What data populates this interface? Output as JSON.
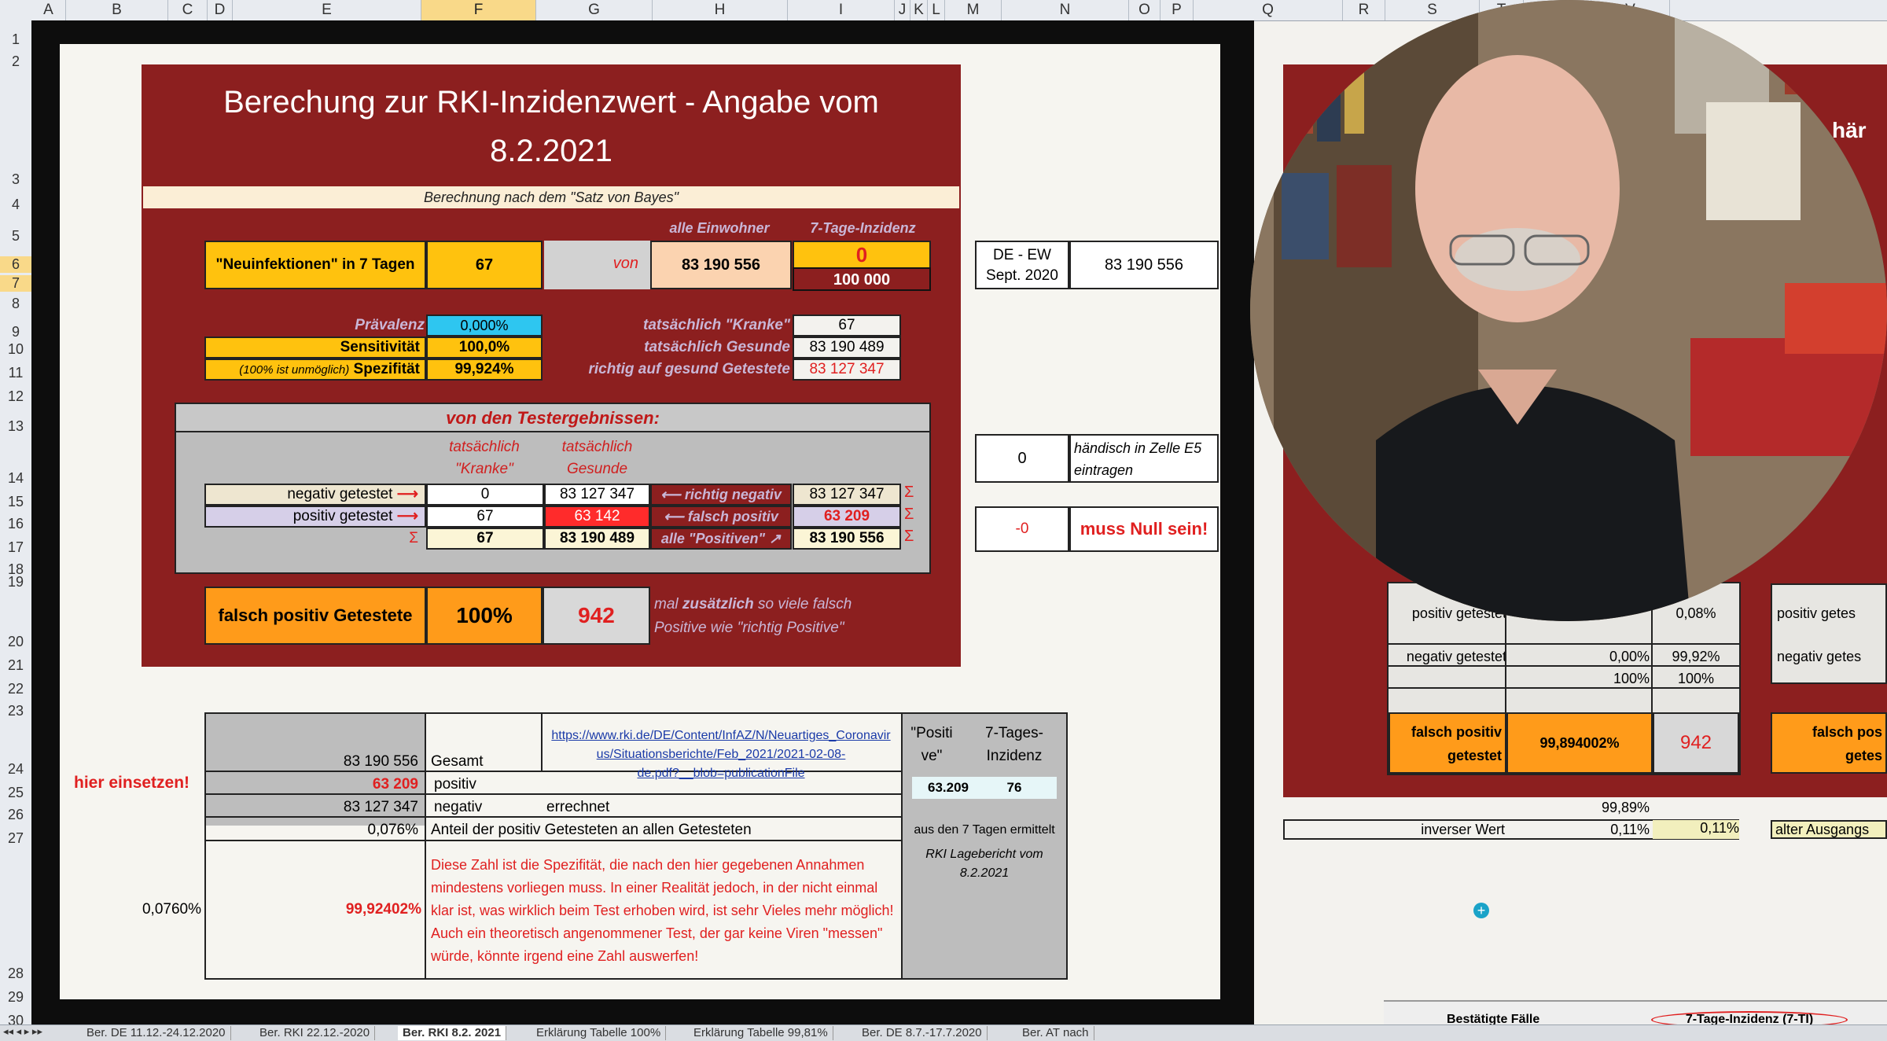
{
  "columns": [
    "A",
    "B",
    "C",
    "D",
    "E",
    "F",
    "G",
    "H",
    "I",
    "J",
    "K",
    "L",
    "M",
    "N",
    "O",
    "P",
    "Q",
    "R",
    "S",
    "T",
    "U",
    "V"
  ],
  "rows": [
    "1",
    "2",
    "3",
    "4",
    "5",
    "6",
    "7",
    "8",
    "9",
    "10",
    "11",
    "12",
    "13",
    "14",
    "15",
    "16",
    "17",
    "18",
    "19",
    "20",
    "21",
    "22",
    "23",
    "24",
    "25",
    "26",
    "27",
    "28",
    "29",
    "30"
  ],
  "selected_column": "F",
  "title_line1": "Berechung zur RKI-Inzidenzwert - Angabe vom",
  "title_line2": "8.2.2021",
  "subtitle": "Berechnung nach dem \"Satz von Bayes\"",
  "hdr_alle_einwohner": "alle Einwohner",
  "hdr_7tage": "7-Tage-Inzidenz",
  "neuinf_label": "\"Neuinfektionen\" in 7 Tagen",
  "neuinf_value": "67",
  "von": "von",
  "einwohner": "83 190 556",
  "inzidenz_top": "0",
  "inzidenz_bottom": "100 000",
  "de_ew_label1": "DE - EW",
  "de_ew_label2": "Sept. 2020",
  "de_ew_value": "83 190 556",
  "praevalenz_label": "Prävalenz",
  "praevalenz_value": "0,000%",
  "sensitivitaet_label": "Sensitivität",
  "sensitivitaet_value": "100,0%",
  "spezifitaet_note": "(100% ist unmöglich)",
  "spezifitaet_label": "Spezifität",
  "spezifitaet_value": "99,924%",
  "kranke_label": "tatsächlich \"Kranke\"",
  "kranke_value": "67",
  "gesunde_label": "tatsächlich Gesunde",
  "gesunde_value": "83 190 489",
  "richtig_gesund_label": "richtig auf gesund Getestete",
  "richtig_gesund_value": "83 127 347",
  "test_header": "von den Testergebnissen:",
  "col_kranke1": "tatsächlich",
  "col_kranke2": "\"Kranke\"",
  "col_gesunde1": "tatsächlich",
  "col_gesunde2": "Gesunde",
  "neg_label": "negativ getestet",
  "neg_kranke": "0",
  "neg_gesunde": "83 127 347",
  "richtig_negativ": "richtig negativ",
  "neg_sum": "83 127 347",
  "pos_label": "positiv getestet",
  "pos_kranke": "67",
  "pos_gesunde": "63 142",
  "falsch_positiv": "falsch positiv",
  "pos_sum": "63 209",
  "sum_symbol": "Σ",
  "sum_kranke": "67",
  "sum_gesunde": "83 190 489",
  "alle_positiven": "alle \"Positiven\"",
  "sum_total": "83 190 556",
  "haendisch_value": "0",
  "haendisch_text1": "händisch in Zelle E5",
  "haendisch_text2": "eintragen",
  "null_value": "-0",
  "null_text": "muss Null sein!",
  "fp_label": "falsch positiv Getestete",
  "fp_percent": "100%",
  "fp_count": "942",
  "fp_note1": "mal zusätzlich so viele falsch",
  "fp_note1_a": "mal ",
  "fp_note1_b": "zusätzlich",
  "fp_note1_c": " so viele falsch",
  "fp_note2": "Positive wie \"richtig Positive\"",
  "hier_einsetzen": "hier einsetzen!",
  "gesamt_value": "83 190 556",
  "gesamt_label": "Gesamt",
  "positiv_value": "63 209",
  "positiv_label": "positiv",
  "negativ_value": "83 127 347",
  "negativ_label": "negativ",
  "errechnet": "errechnet",
  "link_line1": "https://www.rki.de/DE/Content/InfAZ/N/Neuartiges_Coronavir",
  "link_line2": "us/Situationsberichte/Feb_2021/2021-02-08-",
  "link_line3": "de.pdf?__blob=publicationFile",
  "anteil_value": "0,076%",
  "anteil_label": "Anteil der positiv Getesteten an allen Getesteten",
  "pos_head1": "\"Positi",
  "pos_head2": "ve\"",
  "inz_head1": "7-Tages-",
  "inz_head2": "Inzidenz",
  "pos_count": "63.209",
  "inz_count": "76",
  "aus_text": "aus den 7 Tagen ermittelt",
  "rki_text1": "RKI Lagebericht vom",
  "rki_text2": "8.2.2021",
  "left_pct": "0,0760%",
  "spez_big": "99,92402%",
  "paragraph": "Diese Zahl ist die Spezifität, die nach den hier gegebenen Annahmen mindestens vorliegen muss. In einer Realität jedoch, in der nicht einmal klar ist, was wirklich beim Test erhoben wird, ist sehr Vieles mehr möglich! Auch ein theoretisch angenommener Test, der gar keine Viren \"messen\" würde, könnte irgend eine Zahl auswerfen!",
  "right_pos_label": "positiv getestet",
  "right_pos_a": "",
  "right_pos_b": "0,08%",
  "right_pos_label2": "positiv getes",
  "right_neg_label": "negativ getestet",
  "right_neg_a": "0,00%",
  "right_neg_b": "99,92%",
  "right_neg_label2": "negativ getes",
  "right_sum_a": "100%",
  "right_sum_b": "100%",
  "right_fp_label1": "falsch positiv",
  "right_fp_label2": "getestet",
  "right_fp_value": "99,894002%",
  "right_fp_count": "942",
  "right_fp_label3": "falsch pos",
  "right_fp_label4": "getes",
  "right_9989": "99,89%",
  "inverser_label": "inverser Wert",
  "inverser_a": "0,11%",
  "inverser_b": "0,11%",
  "alter_ausgang": "alter Ausgangs",
  "right_top_frag": "här",
  "bottom_frag1": "Bestätigte Fälle",
  "bottom_frag2": "7-Tage-Inzidenz (7-TI)",
  "tabs": [
    "Ber. DE 11.12.-24.12.2020",
    "Ber. RKI 22.12.-2020",
    "Ber. RKI 8.2. 2021",
    "Erklärung Tabelle 100%",
    "Erklärung Tabelle 99,81%",
    "Ber. DE 8.7.-17.7.2020",
    "Ber. AT nach"
  ],
  "colors": {
    "panel": "#8c1f1f",
    "yellow": "#ffc20e",
    "orange": "#ff9b1a",
    "cyan": "#2ec6f0",
    "red": "#ff2b2b"
  }
}
